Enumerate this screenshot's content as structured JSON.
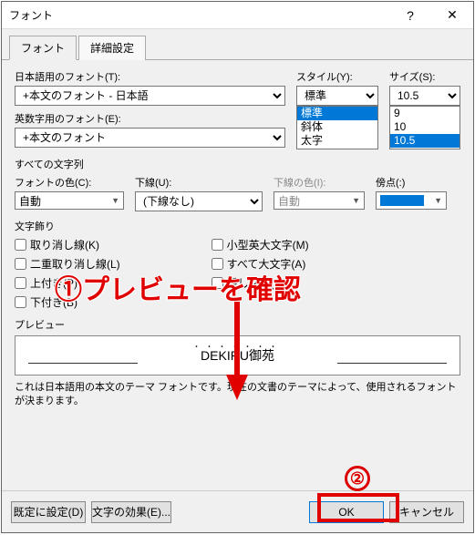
{
  "title": "フォント",
  "tabs": {
    "font": "フォント",
    "advanced": "詳細設定"
  },
  "labels": {
    "jpFont": "日本語用のフォント(T):",
    "enFont": "英数字用のフォント(E):",
    "style": "スタイル(Y):",
    "size": "サイズ(S):",
    "allText": "すべての文字列",
    "fontColor": "フォントの色(C):",
    "underline": "下線(U):",
    "underlineColor": "下線の色(I):",
    "emphasis": "傍点(:)",
    "decoration": "文字飾り",
    "preview": "プレビュー"
  },
  "values": {
    "jpFont": "+本文のフォント - 日本語",
    "enFont": "+本文のフォント",
    "style": "標準",
    "size": "10.5",
    "fontColor": "自動",
    "underline": "(下線なし)",
    "underlineColor": "自動"
  },
  "styleList": [
    "標準",
    "斜体",
    "太字"
  ],
  "sizeList": [
    "9",
    "10",
    "10.5"
  ],
  "checks": {
    "strike": "取り消し線(K)",
    "dstrike": "二重取り消し線(L)",
    "sup": "上付き(P)",
    "sub": "下付き(B)",
    "smallcaps": "小型英大文字(M)",
    "allcaps": "すべて大文字(A)",
    "hidden": "隠し文字(H)"
  },
  "previewText": "DEKIRU御苑",
  "description": "これは日本語用の本文のテーマ フォントです。現在の文書のテーマによって、使用されるフォントが決まります。",
  "buttons": {
    "default": "既定に設定(D)",
    "effects": "文字の効果(E)...",
    "ok": "OK",
    "cancel": "キャンセル"
  },
  "annotations": {
    "num1": "①",
    "num2": "②",
    "text1": "プレビューを確認"
  }
}
